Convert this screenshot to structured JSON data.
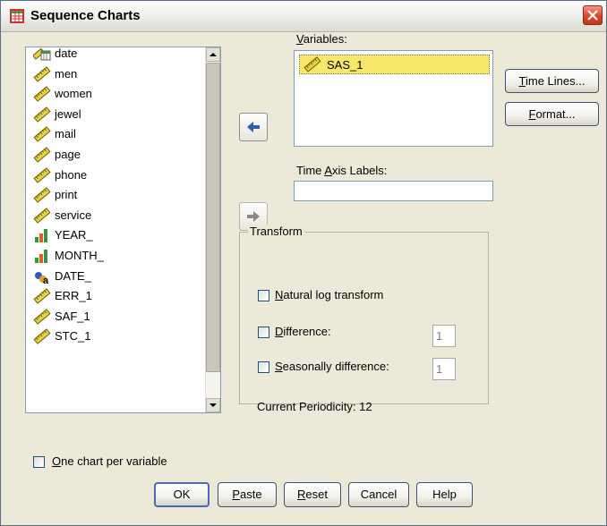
{
  "window": {
    "title": "Sequence Charts"
  },
  "source_variables": {
    "items": [
      {
        "label": "date",
        "icon": "date-variable-icon"
      },
      {
        "label": "men",
        "icon": "scale-variable-icon"
      },
      {
        "label": "women",
        "icon": "scale-variable-icon"
      },
      {
        "label": "jewel",
        "icon": "scale-variable-icon"
      },
      {
        "label": "mail",
        "icon": "scale-variable-icon"
      },
      {
        "label": "page",
        "icon": "scale-variable-icon"
      },
      {
        "label": "phone",
        "icon": "scale-variable-icon"
      },
      {
        "label": "print",
        "icon": "scale-variable-icon"
      },
      {
        "label": "service",
        "icon": "scale-variable-icon"
      },
      {
        "label": "YEAR_",
        "icon": "ordinal-variable-icon"
      },
      {
        "label": "MONTH_",
        "icon": "ordinal-variable-icon"
      },
      {
        "label": "DATE_",
        "icon": "nominal-string-variable-icon"
      },
      {
        "label": "ERR_1",
        "icon": "scale-variable-icon"
      },
      {
        "label": "SAF_1",
        "icon": "scale-variable-icon"
      },
      {
        "label": "STC_1",
        "icon": "scale-variable-icon"
      }
    ]
  },
  "variables": {
    "label_pre": "",
    "label_key": "V",
    "label_post": "ariables:",
    "items": [
      {
        "label": "SAS_1",
        "icon": "scale-variable-icon"
      }
    ]
  },
  "time_axis": {
    "label_pre": "Time ",
    "label_key": "A",
    "label_post": "xis Labels:",
    "value": ""
  },
  "transform": {
    "title": "Transform",
    "natural_log": {
      "checked": false,
      "label_pre": "",
      "label_key": "N",
      "label_post": "atural log transform"
    },
    "difference": {
      "checked": false,
      "label_pre": "",
      "label_key": "D",
      "label_post": "ifference:",
      "value": "1"
    },
    "seasonal": {
      "checked": false,
      "label_pre": "",
      "label_key": "S",
      "label_post": "easonally difference:",
      "value": "1"
    },
    "periodicity": "Current Periodicity:  12"
  },
  "one_chart": {
    "checked": false,
    "label_pre": "",
    "label_key": "O",
    "label_post": "ne chart per variable"
  },
  "side_buttons": {
    "time_lines": {
      "pre": "",
      "key": "T",
      "post": "ime Lines..."
    },
    "format": {
      "pre": "",
      "key": "F",
      "post": "ormat..."
    }
  },
  "bottom_buttons": {
    "ok": "OK",
    "paste": {
      "pre": "",
      "key": "P",
      "post": "aste"
    },
    "reset": {
      "pre": "",
      "key": "R",
      "post": "eset"
    },
    "cancel": "Cancel",
    "help": "Help"
  },
  "colors": {
    "dialog_bg": "#ece9d8",
    "selection": "#f7e76a",
    "arrow_active": "#2d5fb0",
    "arrow_disabled": "#8a8a8a"
  }
}
